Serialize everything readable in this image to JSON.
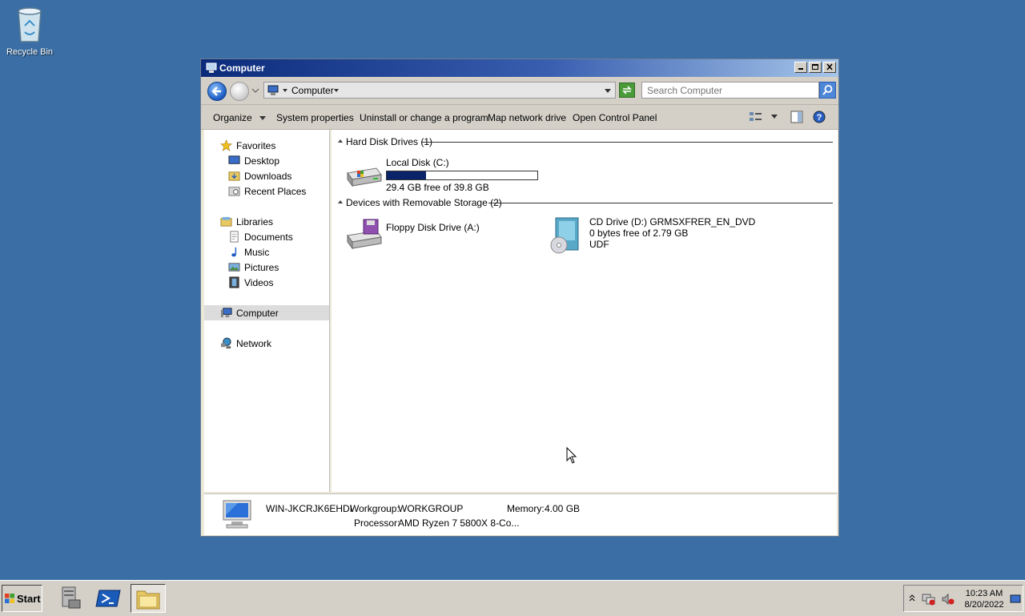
{
  "desktop": {
    "recycle_bin_label": "Recycle Bin"
  },
  "window": {
    "title": "Computer",
    "address": {
      "crumb": "Computer"
    },
    "search": {
      "placeholder": "Search Computer"
    },
    "toolbar": {
      "organize": "Organize",
      "system_properties": "System properties",
      "uninstall": "Uninstall or change a program",
      "map_drive": "Map network drive",
      "control_panel": "Open Control Panel"
    },
    "nav": {
      "favorites": "Favorites",
      "desktop": "Desktop",
      "downloads": "Downloads",
      "recent": "Recent Places",
      "libraries": "Libraries",
      "documents": "Documents",
      "music": "Music",
      "pictures": "Pictures",
      "videos": "Videos",
      "computer": "Computer",
      "network": "Network"
    },
    "groups": {
      "hdd": {
        "header": "Hard Disk Drives (1)",
        "drives": [
          {
            "name": "Local Disk (C:)",
            "free_text": "29.4 GB free of 39.8 GB",
            "used_fraction": 0.26
          }
        ]
      },
      "removable": {
        "header": "Devices with Removable Storage (2)",
        "drives": [
          {
            "name": "Floppy Disk Drive (A:)"
          },
          {
            "name": "CD Drive (D:) GRMSXFRER_EN_DVD",
            "free_text": "0 bytes free of 2.79 GB",
            "fs": "UDF"
          }
        ]
      }
    },
    "details": {
      "computer_name": "WIN-JKCRJK6EHDI",
      "workgroup_label": "Workgroup:",
      "workgroup": "WORKGROUP",
      "memory_label": "Memory:",
      "memory": "4.00 GB",
      "processor_label": "Processor:",
      "processor": "AMD Ryzen 7 5800X 8-Co..."
    }
  },
  "taskbar": {
    "start": "Start",
    "time": "10:23 AM",
    "date": "8/20/2022"
  }
}
